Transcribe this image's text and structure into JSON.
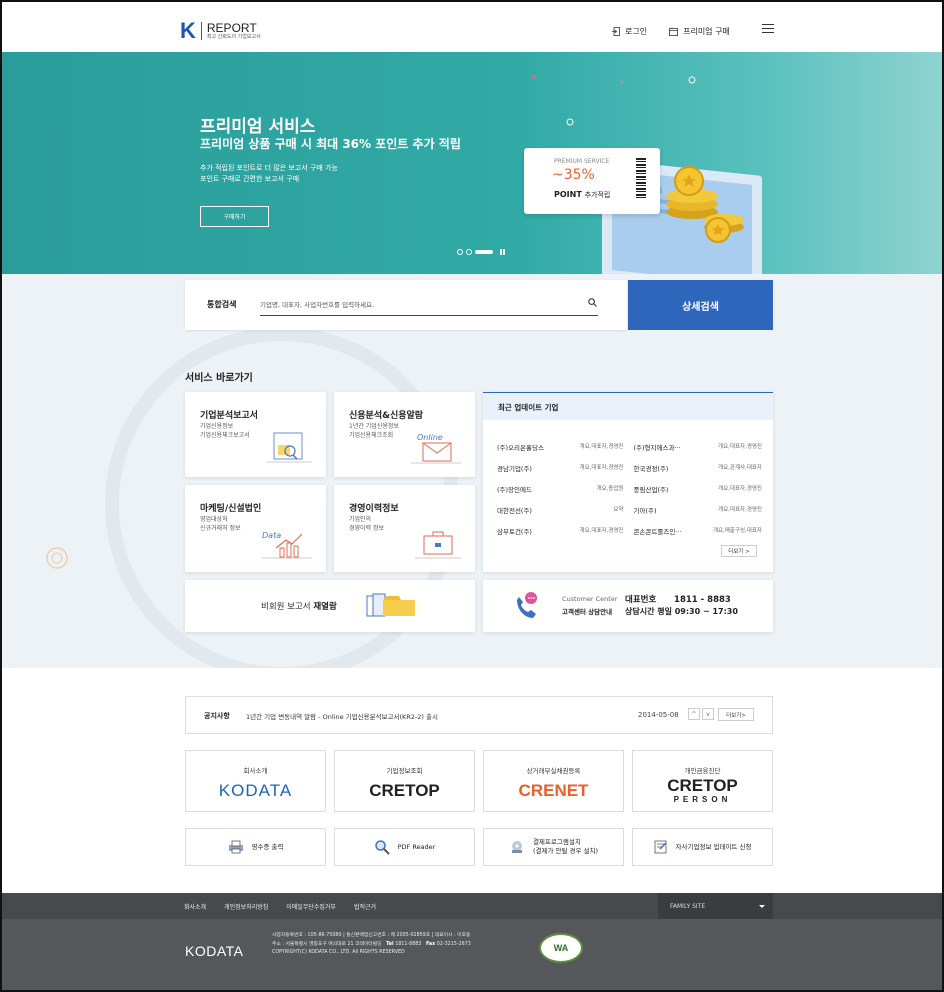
{
  "header": {
    "logo_mark": "K",
    "logo_title": "REPORT",
    "logo_subtitle": "최고 신뢰도의 기업보고서",
    "login": "로그인",
    "premium_buy": "프리미엄 구매"
  },
  "hero": {
    "title": "프리미엄 서비스",
    "subtitle": "프리미엄 상품 구매 시 최대 36% 포인트 추가 적립",
    "desc_line1": "추가 적립된 포인트로 더 많은 보고서 구매 가능",
    "desc_line2": "포인트 구매로 간편한 보고서 구매",
    "button": "구매하기",
    "ticket_label": "PREMIUM SERVICE",
    "ticket_percent": "~35%",
    "ticket_point": "POINT",
    "ticket_point_suffix": "추가적립"
  },
  "search": {
    "label": "통합검색",
    "placeholder": "기업명, 대표자, 사업자번호를 입력하세요.",
    "advanced": "상세검색"
  },
  "services": {
    "title": "서비스 바로가기",
    "cards": [
      {
        "title": "기업분석보고서",
        "sub1": "기업신용정보",
        "sub2": "기업신용체크보고서"
      },
      {
        "title": "신용분석&신용알람",
        "sub1": "1년간 기업신용정보",
        "sub2": "기업신용체크조회",
        "tag": "Online"
      },
      {
        "title": "마케팅/신설법인",
        "sub1": "영업대상처",
        "sub2": "신규거래처 정보",
        "tag": "Data"
      },
      {
        "title": "경영이력정보",
        "sub1": "기업인의",
        "sub2": "경영이력 정보"
      }
    ],
    "reopen_prefix": "비회원 보고서 ",
    "reopen_bold": "재열람"
  },
  "updates": {
    "title": "최근 업데이트 기업",
    "rows": [
      [
        {
          "name": "(주)오리온홀딩스",
          "tags": "개요,대표자,경영진"
        },
        {
          "name": "(주)형지에스과···",
          "tags": "개요,대표자,경영진"
        }
      ],
      [
        {
          "name": "경남기업(주)",
          "tags": "개요,대표자,경영진"
        },
        {
          "name": "한국경정(주)",
          "tags": "개요,관계사,대표자"
        }
      ],
      [
        {
          "name": "(주)장인에드",
          "tags": "개요,종업원"
        },
        {
          "name": "풍림산업(주)",
          "tags": "개요,대표자,경영진"
        }
      ],
      [
        {
          "name": "대한전선(주)",
          "tags": "요약"
        },
        {
          "name": "기아(주)",
          "tags": "개요,대표자,경영진"
        }
      ],
      [
        {
          "name": "삼부토건(주)",
          "tags": "개요,대표자,경영진"
        },
        {
          "name": "콘손콘트롤즈인···",
          "tags": "개요,매출구성,대표자"
        }
      ]
    ],
    "more": "더보기 >"
  },
  "customer": {
    "label_en": "Customer Center",
    "label_ko": "고객센터 상담안내",
    "phone_label": "대표번호",
    "phone": "1811 - 8883",
    "hours": "상담시간 평일 09:30 ~ 17:30"
  },
  "notice": {
    "label": "공지사항",
    "text": "1년간 기업 변동내역 알람 - Online 기업신용분석보고서(KR2-2) 출시",
    "date": "2014-05-08",
    "prev": "^",
    "next": "v",
    "more": "더보기>"
  },
  "brands": [
    {
      "label": "회사소개",
      "logo": "KODATA"
    },
    {
      "label": "기업정보조회",
      "logo": "CRETOP"
    },
    {
      "label": "상거래부실채권등록",
      "logo": "CRENET"
    },
    {
      "label": "개인금융진단",
      "logo": "CRETOP",
      "logo_sub": "PERSON"
    }
  ],
  "utilities": [
    {
      "label": "영수증 출력"
    },
    {
      "label": "PDF Reader"
    },
    {
      "label": "결제프로그램설치",
      "sub": "(결제가 안될 경우 설치)"
    },
    {
      "label": "자사기업정보 업데이트 신청"
    }
  ],
  "footer": {
    "links": [
      "회사소개",
      "개인정보처리방침",
      "이메일무단수집거부",
      "법적근거"
    ],
    "family_site": "FAMILY SITE",
    "logo": "KODATA",
    "info_line1": "사업자등록번호 : 105-86-75080 | 통신판매업신고번호 : 제 2005-02859호 | 대표이사 : 이호동",
    "info_line2_pre": "주소 : 서울특별시 영등포구 여의대로 21 코데이타빌딩",
    "tel_label": "Tel",
    "tel": "1811-8883",
    "fax_label": "Fax",
    "fax": "02-3215-2673",
    "copyright": "COPYRIGHT(C) KODATA CO., LTD. All RIGHTS RESERVED",
    "wa": "WA"
  },
  "colors": {
    "accent": "#2e66bb",
    "hero": "#2a9d9a",
    "footer": "#55575b",
    "orange": "#e8602a"
  }
}
